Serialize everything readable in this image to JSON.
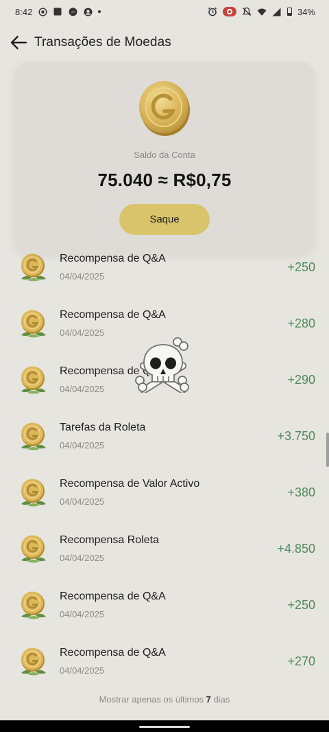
{
  "status_bar": {
    "time": "8:42",
    "battery": "34%",
    "left_icons": [
      "record-icon",
      "square-app-icon",
      "messenger-icon",
      "shield-app-icon"
    ],
    "right_icons": [
      "alarm-icon",
      "screen-record-icon",
      "mute-icon",
      "wifi-icon",
      "signal-icon",
      "battery-icon"
    ]
  },
  "header": {
    "title": "Transações de Moedas",
    "back_icon": "arrow-left-icon"
  },
  "balance": {
    "label": "Saldo da Conta",
    "value": "75.040 ≈ R$0,75",
    "withdraw_label": "Saque",
    "coin_icon": "gold-coin-icon"
  },
  "transactions": [
    {
      "title": "Recompensa de Q&A",
      "date": "04/04/2025",
      "amount": "+250"
    },
    {
      "title": "Recompensa de Q&A",
      "date": "04/04/2025",
      "amount": "+280"
    },
    {
      "title": "Recompensa de Q&A",
      "date": "04/04/2025",
      "amount": "+290"
    },
    {
      "title": "Tarefas da Roleta",
      "date": "04/04/2025",
      "amount": "+3.750"
    },
    {
      "title": "Recompensa de Valor Activo",
      "date": "04/04/2025",
      "amount": "+380"
    },
    {
      "title": "Recompensa Roleta",
      "date": "04/04/2025",
      "amount": "+4.850"
    },
    {
      "title": "Recompensa de Q&A",
      "date": "04/04/2025",
      "amount": "+250"
    },
    {
      "title": "Recompensa de Q&A",
      "date": "04/04/2025",
      "amount": "+270"
    }
  ],
  "overlay": {
    "sticker": "skull-crossbones-icon"
  },
  "footer": {
    "prefix": "Mostrar apenas os últimos",
    "days": "7",
    "suffix": "dias"
  },
  "colors": {
    "accent": "#d9c46b",
    "positive": "#4f8a5c",
    "background": "#e6e5df"
  }
}
